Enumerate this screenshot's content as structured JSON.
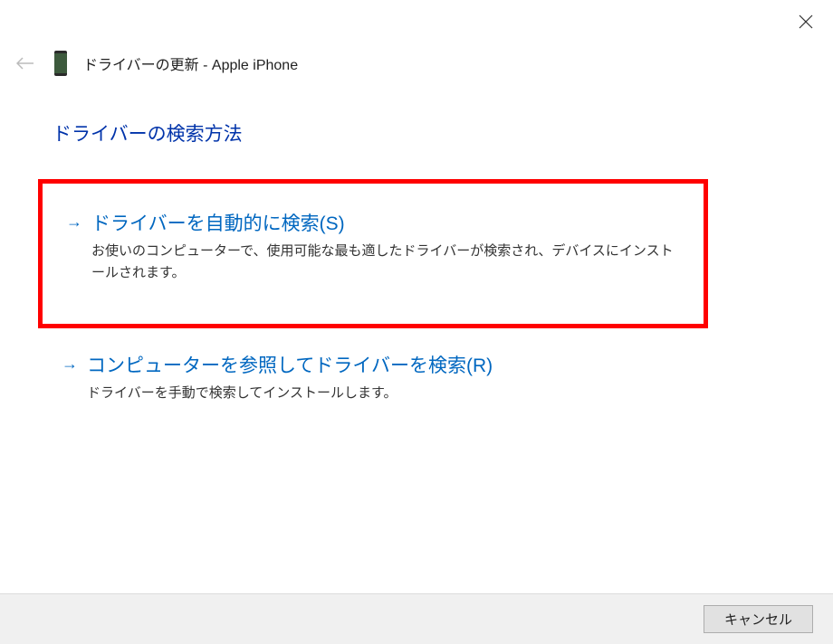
{
  "header": {
    "title": "ドライバーの更新 - Apple iPhone"
  },
  "main": {
    "heading": "ドライバーの検索方法",
    "options": [
      {
        "title": "ドライバーを自動的に検索(S)",
        "description": "お使いのコンピューターで、使用可能な最も適したドライバーが検索され、デバイスにインストールされます。"
      },
      {
        "title": "コンピューターを参照してドライバーを検索(R)",
        "description": "ドライバーを手動で検索してインストールします。"
      }
    ]
  },
  "footer": {
    "cancel_label": "キャンセル"
  }
}
